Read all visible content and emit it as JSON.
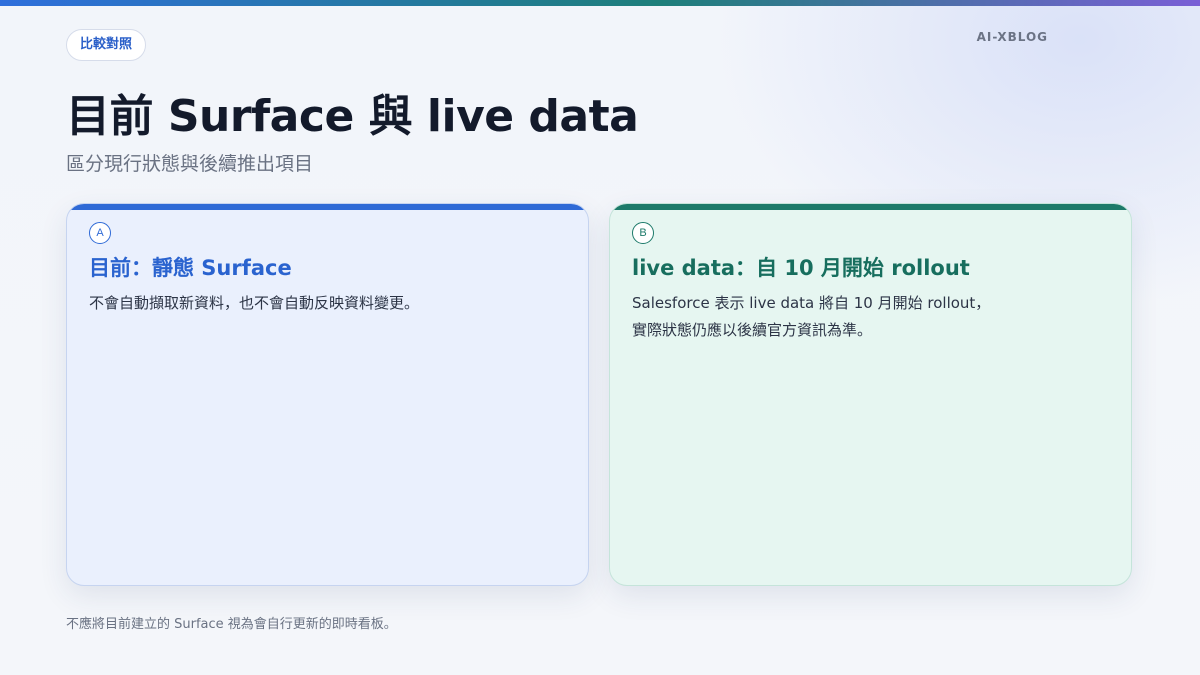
{
  "header": {
    "tag": "比較對照",
    "brand": "AI-XBLOG",
    "title": "目前 Surface 與 live data",
    "subtitle": "區分現行狀態與後續推出項目"
  },
  "cards": [
    {
      "badge": "A",
      "title": "目前：靜態 Surface",
      "body_lines": [
        "不會自動擷取新資料，也不會自動反映資料變更。"
      ]
    },
    {
      "badge": "B",
      "title": "live data：自 10 月開始 rollout",
      "body_lines": [
        "Salesforce 表示 live data 將自 10 月開始 rollout，",
        "實際狀態仍應以後續官方資訊為準。"
      ]
    }
  ],
  "footnote": "不應將目前建立的 Surface 視為會自行更新的即時看板。",
  "colors": {
    "accent_blue": "#2f6ad6",
    "accent_green": "#1d7a6a",
    "card_a_bg": "#eaf0fd",
    "card_b_bg": "#e6f6f1"
  }
}
